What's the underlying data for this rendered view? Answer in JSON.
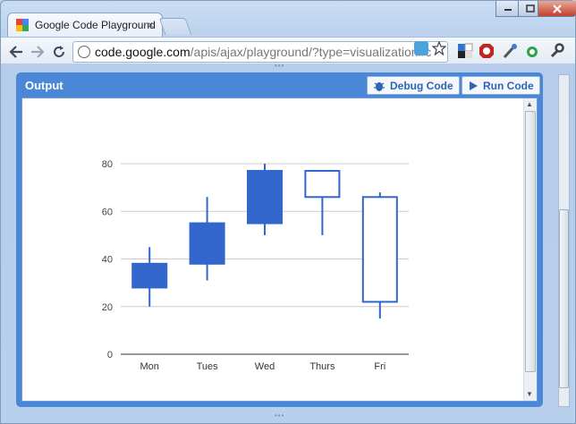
{
  "browser": {
    "tab_title": "Google Code Playground",
    "tab_close": "×",
    "url_host": "code.google.com",
    "url_path": "/apis/ajax/playground/?type=visualization#c"
  },
  "panel": {
    "title": "Output",
    "debug_label": "Debug Code",
    "run_label": "Run Code"
  },
  "colors": {
    "accent": "#4a87d6",
    "candle_fill": "#3366cc",
    "candle_hollow": "#ffffff"
  },
  "chart_data": {
    "type": "candlestick",
    "categories": [
      "Mon",
      "Tues",
      "Wed",
      "Thurs",
      "Fri"
    ],
    "series": [
      {
        "low": 20,
        "open": 28,
        "close": 38,
        "high": 45
      },
      {
        "low": 31,
        "open": 38,
        "close": 55,
        "high": 66
      },
      {
        "low": 50,
        "open": 55,
        "close": 77,
        "high": 80
      },
      {
        "low": 50,
        "open": 77,
        "close": 66,
        "high": 77
      },
      {
        "low": 15,
        "open": 66,
        "close": 22,
        "high": 68
      }
    ],
    "filled": [
      true,
      true,
      true,
      false,
      false
    ],
    "y_ticks": [
      "0",
      "20",
      "40",
      "60",
      "80"
    ],
    "ylim": [
      0,
      80
    ],
    "grid": true
  }
}
